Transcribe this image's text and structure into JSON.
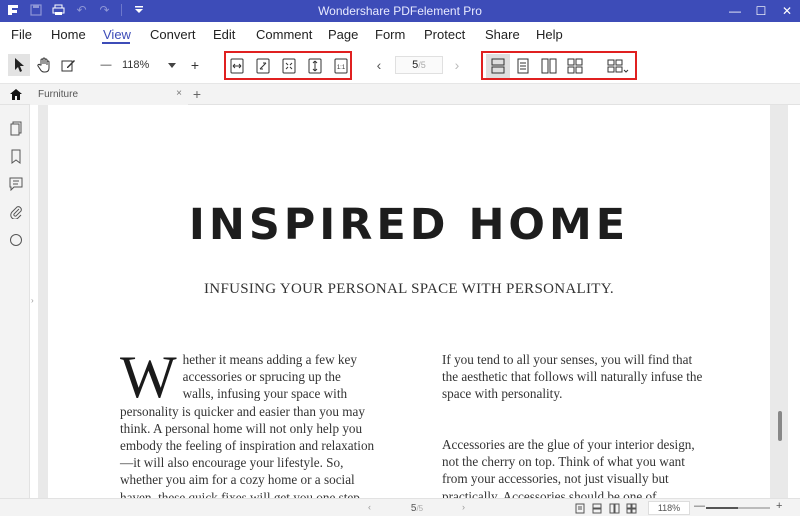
{
  "window": {
    "title": "Wondershare PDFelement Pro",
    "controls": [
      "—",
      "☐",
      "✕"
    ]
  },
  "menu": {
    "items": [
      "File",
      "Home",
      "View",
      "Convert",
      "Edit",
      "Comment",
      "Page",
      "Form",
      "Protect",
      "Share",
      "Help"
    ],
    "active": "View"
  },
  "toolbar": {
    "zoom_value": "118%",
    "zoom_minus": "—",
    "zoom_plus": "+",
    "current_page": "5",
    "total_pages": "/5",
    "prev": "‹",
    "next": "›",
    "actual_size_label": "1:1",
    "highlight_color": "#e02020"
  },
  "tabs": {
    "items": [
      {
        "label": "Furniture"
      }
    ],
    "close": "×",
    "add": "+"
  },
  "document": {
    "heading": "INSPIRED HOME",
    "subheading": "INFUSING YOUR PERSONAL SPACE WITH PERSONALITY.",
    "dropcap": "W",
    "col1_text": "hether it means adding a few key accessories or sprucing up the walls, infusing your space with personality is quicker and easier than you may think. A personal home will not only help you embody the feeling of inspiration and relaxation—it will also encourage your lifestyle. So, whether you aim for a cozy home or a social haven, these quick fixes will get you one step closer to your",
    "col2_text": "If you tend to all your senses, you will find that the aesthetic that follows will naturally infuse the space with personality.",
    "col3_text": "Accessories are the glue of your interior design, not the cherry on top. Think of what you want from your accessories, not just visually but practically. Accessories should be one of"
  },
  "statusbar": {
    "current_page": "5",
    "total_pages": "/5",
    "prev": "‹",
    "next": "›",
    "zoom": "118%",
    "zoom_minus": "—",
    "zoom_plus": "+",
    "zoom_level": 0.5
  },
  "colors": {
    "accent": "#3d4cb8",
    "highlight": "#e02020"
  }
}
